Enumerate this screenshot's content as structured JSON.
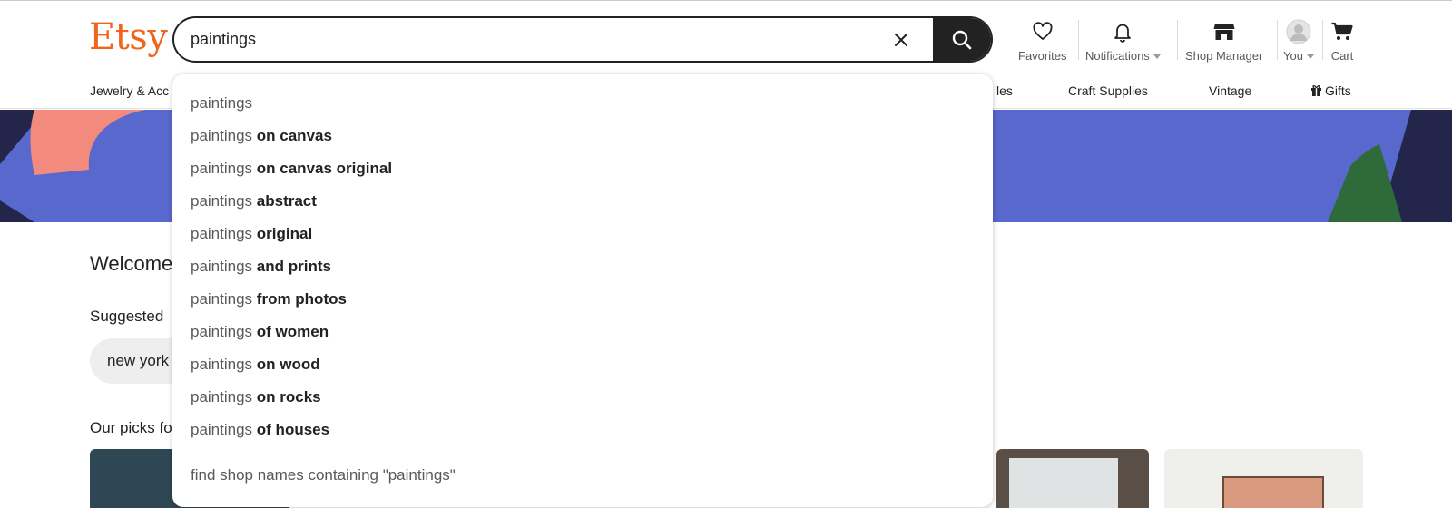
{
  "header": {
    "logo": "Etsy",
    "search_value": "paintings",
    "nav": {
      "favorites": "Favorites",
      "notifications": "Notifications",
      "shop_manager": "Shop Manager",
      "you": "You",
      "cart": "Cart"
    }
  },
  "categories": {
    "jewelry": "Jewelry & Acc",
    "home_partial": "les",
    "craft": "Craft Supplies",
    "vintage": "Vintage",
    "gifts": "Gifts"
  },
  "main": {
    "welcome": "Welcome",
    "suggested": "Suggested",
    "chip": "new york",
    "picks": "Our picks fo"
  },
  "dropdown": {
    "query": "paintings",
    "suggestions": [
      {
        "prefix": "paintings",
        "rest": ""
      },
      {
        "prefix": "paintings",
        "rest": " on canvas"
      },
      {
        "prefix": "paintings",
        "rest": " on canvas original"
      },
      {
        "prefix": "paintings",
        "rest": " abstract"
      },
      {
        "prefix": "paintings",
        "rest": " original"
      },
      {
        "prefix": "paintings",
        "rest": " and prints"
      },
      {
        "prefix": "paintings",
        "rest": " from photos"
      },
      {
        "prefix": "paintings",
        "rest": " of women"
      },
      {
        "prefix": "paintings",
        "rest": " on wood"
      },
      {
        "prefix": "paintings",
        "rest": " on rocks"
      },
      {
        "prefix": "paintings",
        "rest": " of houses"
      }
    ],
    "shop_names": "find shop names containing \"paintings\""
  },
  "colors": {
    "brand": "#F1641E",
    "banner": "#5868cc",
    "banner_dark": "#23254a",
    "salmon": "#f28b7e",
    "green": "#2e6a3a"
  }
}
